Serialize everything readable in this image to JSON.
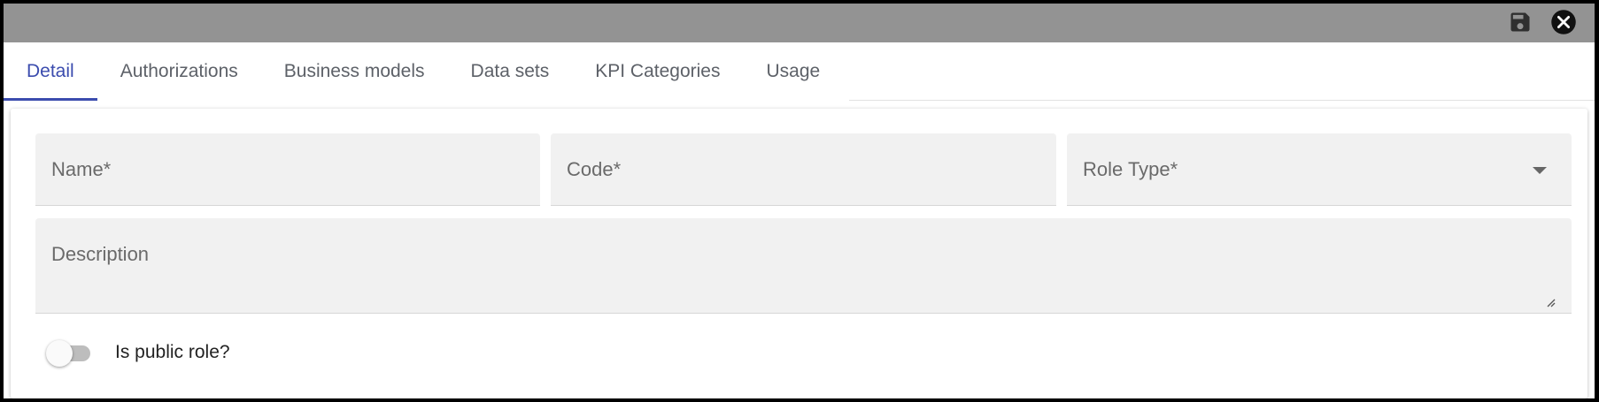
{
  "toolbar": {
    "save_icon": "save-icon",
    "close_icon": "close-icon"
  },
  "tabs": [
    {
      "label": "Detail",
      "active": true
    },
    {
      "label": "Authorizations",
      "active": false
    },
    {
      "label": "Business models",
      "active": false
    },
    {
      "label": "Data sets",
      "active": false
    },
    {
      "label": "KPI Categories",
      "active": false
    },
    {
      "label": "Usage",
      "active": false
    }
  ],
  "form": {
    "name": {
      "placeholder": "Name*",
      "value": ""
    },
    "code": {
      "placeholder": "Code*",
      "value": ""
    },
    "role_type": {
      "placeholder": "Role Type*",
      "value": ""
    },
    "description": {
      "placeholder": "Description",
      "value": ""
    },
    "public_role": {
      "label": "Is public role?",
      "checked": false
    }
  },
  "colors": {
    "toolbar_bg": "#939393",
    "accent": "#3b4cae",
    "field_bg": "#f1f1f1"
  }
}
